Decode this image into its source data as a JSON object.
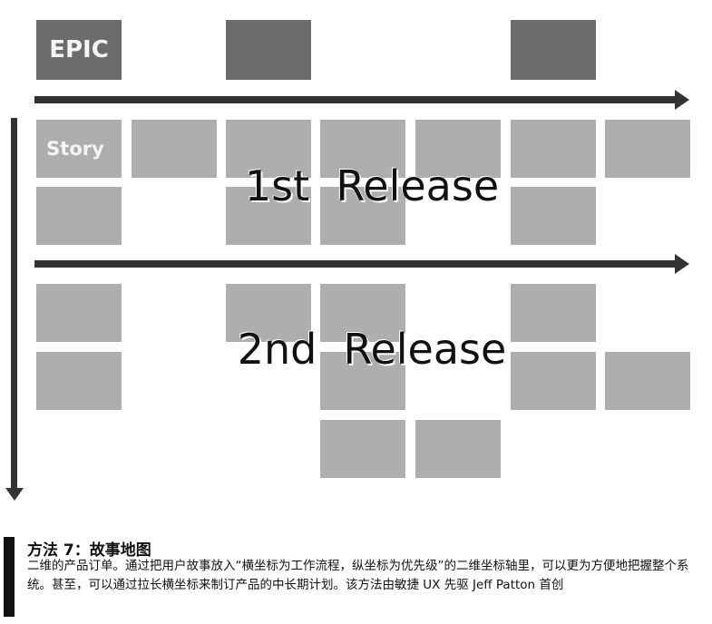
{
  "diagram": {
    "epic_label": "EPIC",
    "story_label": "Story",
    "release_1": "1st  Release",
    "release_2": "2nd  Release",
    "colors": {
      "epic": "#6c6c6c",
      "story": "#aeaeae",
      "arrow": "#333333"
    }
  },
  "caption": {
    "title": "方法 7：故事地图",
    "body": "二维的产品订单。通过把用户故事放入“横坐标为工作流程，纵坐标为优先级”的二维坐标轴里，可以更为方便地把握整个系统。甚至，可以通过拉长横坐标来制订产品的中长期计划。该方法由敏捷 UX 先驱 Jeff Patton 首创"
  }
}
